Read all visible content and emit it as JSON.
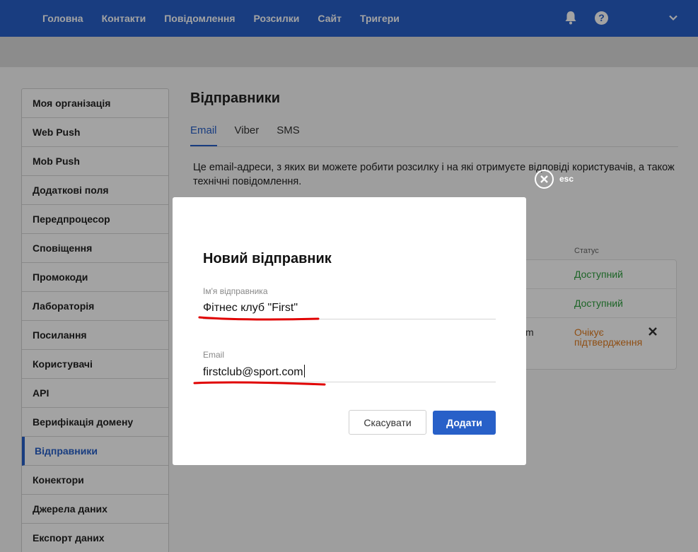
{
  "topnav": {
    "items": [
      "Головна",
      "Контакти",
      "Повідомлення",
      "Розсилки",
      "Сайт",
      "Тригери"
    ],
    "help_label": "?"
  },
  "sidebar": {
    "items": [
      {
        "label": "Моя організація"
      },
      {
        "label": "Web Push"
      },
      {
        "label": "Mob Push"
      },
      {
        "label": "Додаткові поля"
      },
      {
        "label": "Передпроцесор"
      },
      {
        "label": "Сповіщення"
      },
      {
        "label": "Промокоди"
      },
      {
        "label": "Лабораторія"
      },
      {
        "label": "Посилання"
      },
      {
        "label": "Користувачі"
      },
      {
        "label": "API"
      },
      {
        "label": "Верифікація домену"
      },
      {
        "label": "Відправники",
        "active": true
      },
      {
        "label": "Конектори"
      },
      {
        "label": "Джерела даних"
      },
      {
        "label": "Експорт даних"
      }
    ]
  },
  "main": {
    "title": "Відправники",
    "tabs": [
      {
        "label": "Email",
        "active": true
      },
      {
        "label": "Viber"
      },
      {
        "label": "SMS"
      }
    ],
    "description": "Це email-адреси, з яких ви можете робити розсилку і на які отримуєте відповіді користувачів, а також технічні повідомлення.",
    "table": {
      "status_header": "Статус",
      "rows": [
        {
          "status": "Доступний",
          "state": "ok"
        },
        {
          "status": "Доступний",
          "state": "ok"
        },
        {
          "email_fragment": "m",
          "status": "Очікує підтвердження",
          "state": "pending"
        }
      ]
    }
  },
  "overlay": {
    "esc_label": "esc"
  },
  "modal": {
    "title": "Новий відправник",
    "name_field": {
      "label": "Ім'я відправника",
      "value": "Фітнес клуб \"First\""
    },
    "email_field": {
      "label": "Email",
      "value": "firstclub@sport.com"
    },
    "cancel_label": "Скасувати",
    "add_label": "Додати"
  },
  "colors": {
    "primary": "#2860c8",
    "ok": "#2e9e3e",
    "pending": "#e07b1e",
    "annotation": "#e00000"
  }
}
